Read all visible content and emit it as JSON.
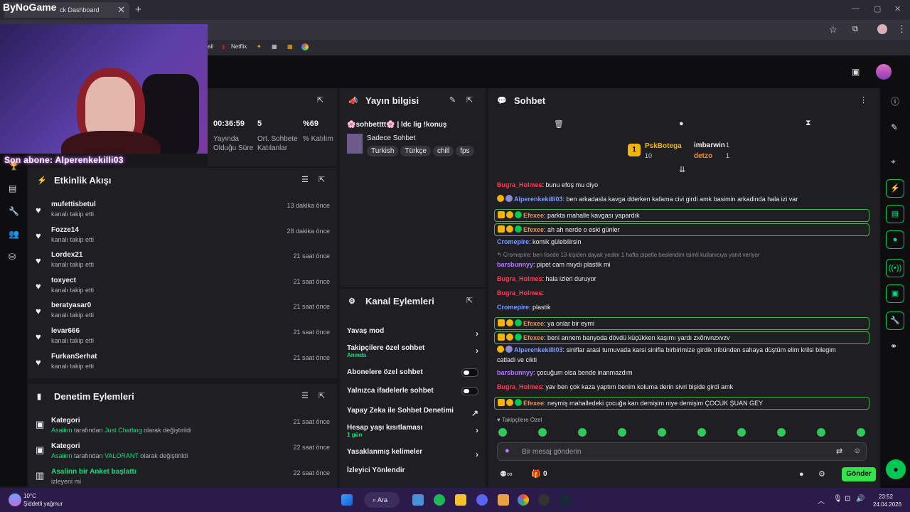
{
  "browser": {
    "tab_title": "ck Dashboard",
    "logo": "ByNoGame"
  },
  "bookmarks": [
    "ail",
    "Netflix"
  ],
  "overlay": {
    "subscriber": "Son abone: Alperenkekilli03"
  },
  "stats": [
    {
      "value": "00:36:59",
      "label": "Yayında Olduğu Süre"
    },
    {
      "value": "5",
      "label": "Ort. Sohbete Katılanlar"
    },
    {
      "value": "%69",
      "label": "% Katılım"
    }
  ],
  "activity": {
    "title": "Etkinlik Akışı",
    "items": [
      {
        "name": "mufettisbetul",
        "sub": "kanalı takip etti",
        "time": "13 dakika önce"
      },
      {
        "name": "Fozze14",
        "sub": "kanalı takip etti",
        "time": "28 dakika önce"
      },
      {
        "name": "Lordex21",
        "sub": "kanalı takip etti",
        "time": "21 saat önce"
      },
      {
        "name": "toxyect",
        "sub": "kanalı takip etti",
        "time": "21 saat önce"
      },
      {
        "name": "beratyasar0",
        "sub": "kanalı takip etti",
        "time": "21 saat önce"
      },
      {
        "name": "levar666",
        "sub": "kanalı takip etti",
        "time": "21 saat önce"
      },
      {
        "name": "FurkanSerhat",
        "sub": "kanalı takip etti",
        "time": "21 saat önce"
      }
    ]
  },
  "moderation": {
    "title": "Denetim Eylemleri",
    "items": [
      {
        "name": "Kategori",
        "user": "Asalinn",
        "mid": " tarafından ",
        "value": "Just Chatting",
        "end": " olarak değiştirildi",
        "time": "21 saat önce"
      },
      {
        "name": "Kategori",
        "user": "Asalinn",
        "mid": " tarafından ",
        "value": "VALORANT",
        "end": " olarak değiştirildi",
        "time": "22 saat önce"
      },
      {
        "name": "Asalinn bir Anket başlattı",
        "user": "",
        "mid": "izleyeni mi",
        "value": "",
        "end": "",
        "time": "22 saat önce"
      }
    ]
  },
  "stream_info": {
    "title": "Yayın bilgisi",
    "stream_title": "🌸sohbetttt🌸 | ldc lig !konuş",
    "category": "Sadece Sohbet",
    "tags": [
      "Turkish",
      "Türkçe",
      "chill",
      "fps"
    ]
  },
  "channel_actions": {
    "title": "Kanal Eylemleri",
    "items": [
      {
        "label": "Yavaş mod",
        "sub": "",
        "control": "chevron"
      },
      {
        "label": "Takipçilere özel sohbet",
        "sub": "Anında",
        "control": "chevron"
      },
      {
        "label": "Abonelere özel sohbet",
        "sub": "",
        "control": "toggle"
      },
      {
        "label": "Yalnızca ifadelerle sohbet",
        "sub": "",
        "control": "toggle"
      },
      {
        "label": "Yapay Zeka ile Sohbet Denetimi",
        "sub": "",
        "control": "external"
      },
      {
        "label": "Hesap yaşı kısıtlaması",
        "sub": "1 gün",
        "control": "chevron"
      },
      {
        "label": "Yasaklanmış kelimeler",
        "sub": "",
        "control": "chevron"
      },
      {
        "label": "İzleyici Yönlendir",
        "sub": "",
        "control": "none"
      }
    ]
  },
  "chat": {
    "title": "Sohbet",
    "leaderboard": [
      {
        "rank": "1",
        "name": "PskBotega",
        "count": "10"
      },
      {
        "rank": "",
        "name": "imbarwin",
        "count": "1"
      },
      {
        "rank": "",
        "name": "detzo",
        "count": "1"
      }
    ],
    "messages": [
      {
        "user": "Bugra_Holmes",
        "color": "red",
        "text": ": bunu efoş mu diyo",
        "badges": 0,
        "hl": false
      },
      {
        "user": "Alperenkekilli03",
        "color": "blue",
        "text": ": ben arkadasla kavga dderken kafama civi girdi amk basimin arkadinda hala izi var",
        "badges": 2,
        "hl": false
      },
      {
        "user": "Efexee",
        "color": "orange",
        "text": ": parkta mahalle kavgası yapardık",
        "badges": 3,
        "hl": true
      },
      {
        "user": "Efexee",
        "color": "orange",
        "text": ": ah ah nerde o eski günler",
        "badges": 3,
        "hl": true
      },
      {
        "user": "Cromepire",
        "color": "blue",
        "text": ": komik gülebilirsin",
        "badges": 0,
        "hl": false
      },
      {
        "user": "",
        "color": "",
        "text": "↰ Cromepire: ben lisede 13 kişiden dayak yedim 1 hafta pipetle beslendim isimli kullanıcıya yanıt veriyor",
        "badges": 0,
        "hl": false,
        "reply": true
      },
      {
        "user": "barsbunnyy",
        "color": "purple",
        "text": ": pipet cam mıydı plastik mi",
        "badges": 0,
        "hl": false
      },
      {
        "user": "Bugra_Holmes",
        "color": "red",
        "text": ": hala izleri duruyor",
        "badges": 0,
        "hl": false
      },
      {
        "user": "Bugra_Holmes",
        "color": "red",
        "text": ":",
        "badges": 0,
        "hl": false
      },
      {
        "user": "Cromepire",
        "color": "blue",
        "text": ": plastik",
        "badges": 0,
        "hl": false
      },
      {
        "user": "Efexee",
        "color": "orange",
        "text": ": ya onlar bir eymi",
        "badges": 3,
        "hl": true
      },
      {
        "user": "Efexee",
        "color": "orange",
        "text": ": beni annem banyoda dövdü küçükken kaşımı yardı zxõnvnzxvzv",
        "badges": 3,
        "hl": true
      },
      {
        "user": "Alperenkekilli03",
        "color": "blue",
        "text": ": siniflar arasi turnuvada karsi sinifla birbirimize girdik tribünden sahaya düştüm elim krilsi bilegim",
        "badges": 2,
        "hl": false
      },
      {
        "user": "",
        "color": "",
        "text": "catladi ve cikti",
        "badges": 0,
        "hl": false,
        "cont": true
      },
      {
        "user": "barsbunnyy",
        "color": "purple",
        "text": ": çocuğum olsa bende inanmazdım",
        "badges": 0,
        "hl": false
      },
      {
        "user": "Bugra_Holmes",
        "color": "red",
        "text": ": yav ben çok kaza yaptım benim koluma derin sivri bişide girdi amk",
        "badges": 0,
        "hl": false
      },
      {
        "user": "Efexee",
        "color": "orange",
        "text": ": neymiş mahalledeki çocuğa karı demişim niye demişim ÇOCUK ŞUAN GEY",
        "badges": 3,
        "hl": true
      }
    ],
    "followers_only": "Takipçilere Özel",
    "input_placeholder": "Bir mesaj gönderin",
    "points": "0",
    "send": "Gönder"
  },
  "taskbar": {
    "weather_temp": "10°C",
    "weather_desc": "Şiddetli yağmur",
    "search": "Ara",
    "time": "23:52",
    "date": "24.04.2026"
  }
}
